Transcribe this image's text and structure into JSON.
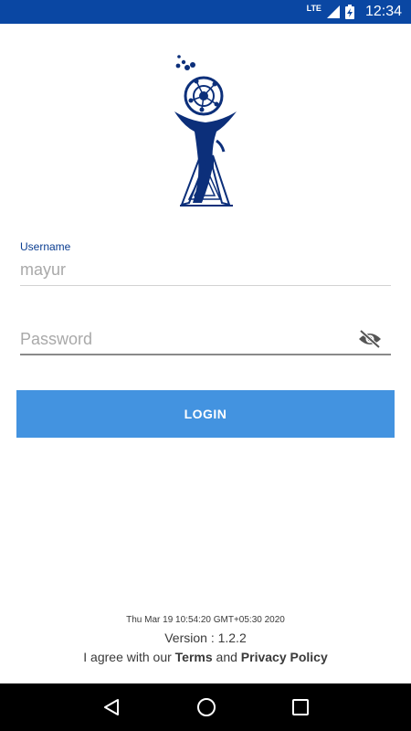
{
  "status_bar": {
    "network": "LTE",
    "time": "12:34",
    "icons": [
      "signal-icon",
      "battery-charging-icon"
    ]
  },
  "logo": {
    "icon": "trophy-molecule-logo"
  },
  "login_form": {
    "username_label": "Username",
    "username_value": "mayur",
    "password_placeholder": "Password",
    "password_toggle_icon": "eye-off-icon",
    "login_button": "LOGIN"
  },
  "footer": {
    "timestamp": "Thu Mar 19 10:54:20 GMT+05:30 2020",
    "version": "Version : 1.2.2",
    "agree_prefix": "I agree with our ",
    "terms": "Terms",
    "and": " and ",
    "privacy": "Privacy Policy"
  },
  "nav_bar": {
    "icons": [
      "back-icon",
      "home-icon",
      "recents-icon"
    ]
  },
  "colors": {
    "status_bar": "#0a47a3",
    "button": "#4393e0",
    "logo": "#0c2f7a",
    "label": "#0a3d91"
  }
}
